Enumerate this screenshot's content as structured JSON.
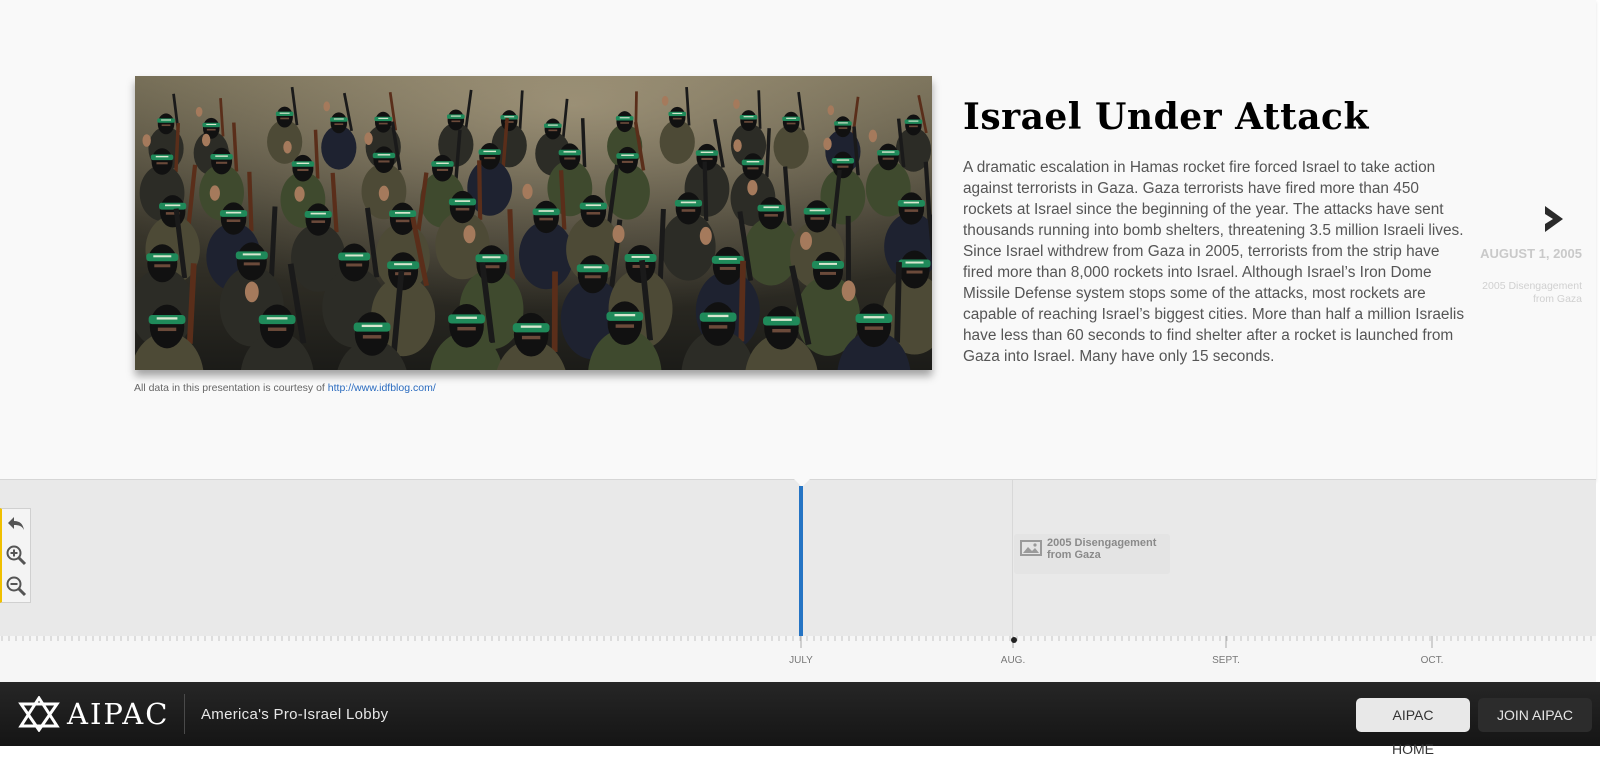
{
  "slide": {
    "headline": "Israel Under Attack",
    "body": "A dramatic escalation in Hamas rocket fire forced Israel to take action against terrorists in Gaza. Gaza terrorists have fired more than 450 rockets at Israel since the beginning of the year. The attacks have sent thousands running into bomb shelters, threatening 3.5 million Israeli lives. Since Israel withdrew from Gaza in 2005, terrorists from the strip have fired more than 8,000 rockets into Israel. Although Israel’s Iron Dome Missile Defense system stops some of the attacks, most rockets are capable of reaching Israel’s biggest cities. More than half a million Israelis have less than 60 seconds to find shelter after a rocket is launched from Gaza into Israel. Many have only 15 seconds.",
    "credit_text": "All data in this presentation is courtesy of ",
    "credit_link": "http://www.idfblog.com/",
    "image_alt": "Crowd of masked armed militants wearing green headbands"
  },
  "next_slide": {
    "icon": "chevron-right-icon",
    "date": "AUGUST 1, 2005",
    "title": "2005 Disengagement from Gaza"
  },
  "timeline": {
    "tools": [
      "back-to-start-icon",
      "zoom-in-icon",
      "zoom-out-icon"
    ],
    "event_label": "2005 Disengagement from Gaza",
    "event_icon": "image-icon",
    "months": [
      "JULY",
      "AUG.",
      "SEPT.",
      "OCT."
    ],
    "marker_color": "#2574c4"
  },
  "footer": {
    "brand": "AIPAC",
    "tagline": "America's Pro-Israel Lobby",
    "buttons": {
      "home": "AIPAC HOME",
      "join": "JOIN AIPAC"
    },
    "logo_icon": "star-of-david-icon"
  }
}
